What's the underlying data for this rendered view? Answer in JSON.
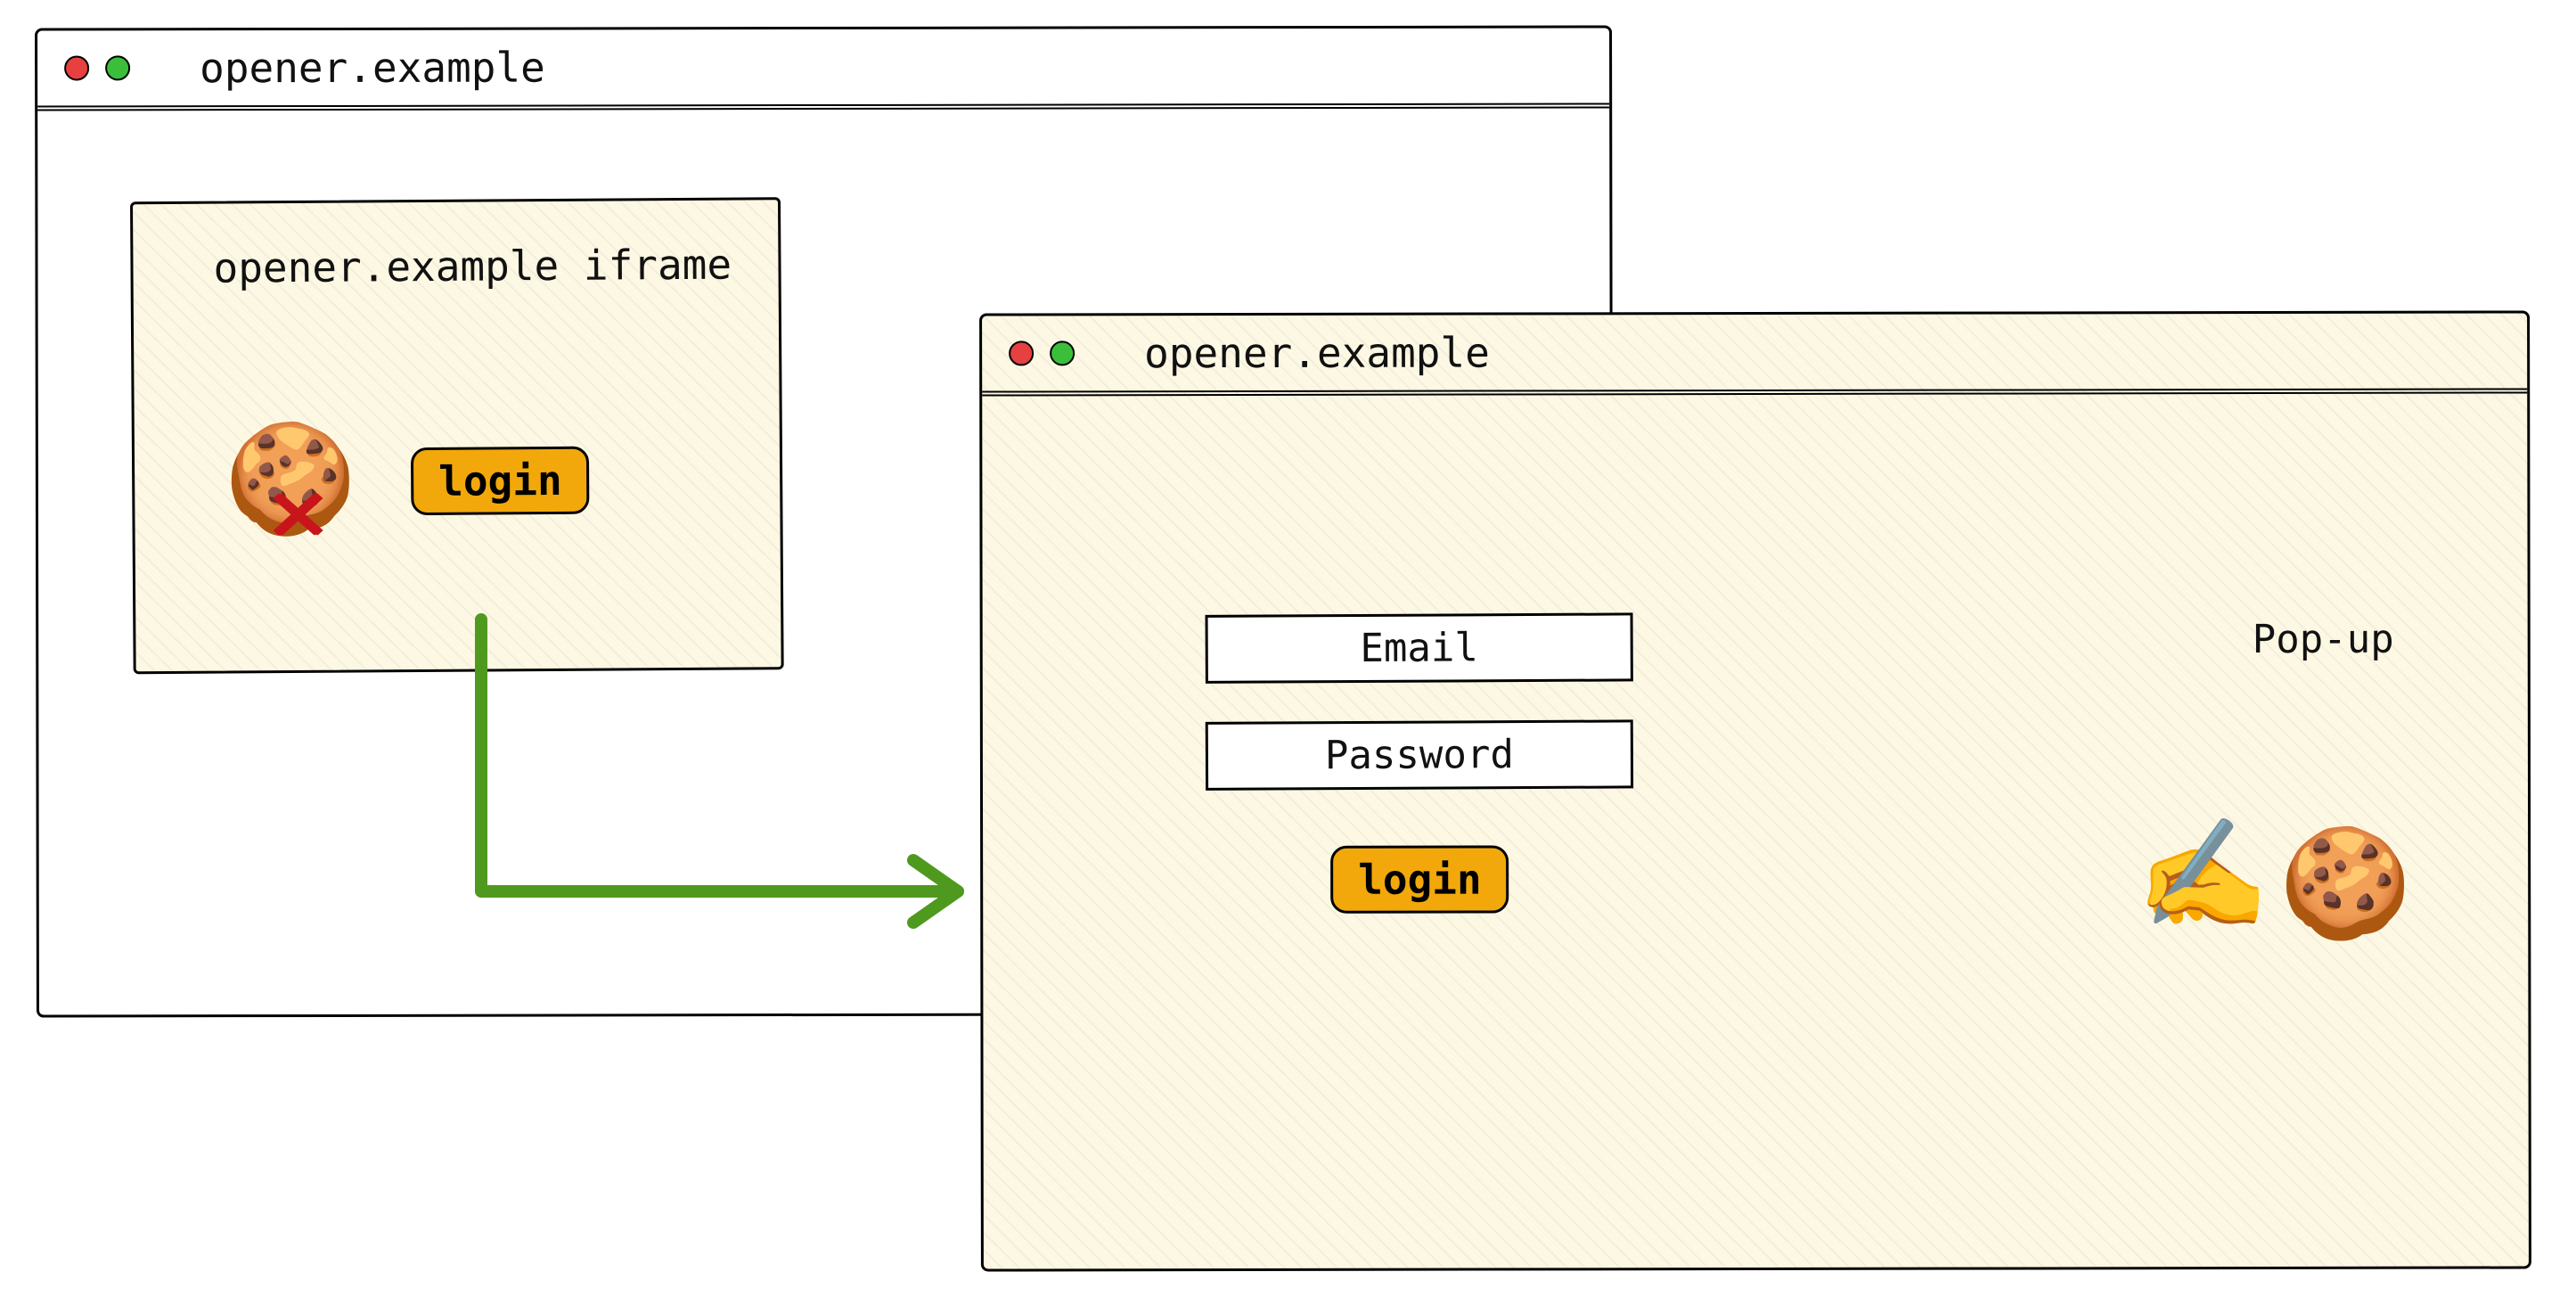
{
  "left_window": {
    "address": "opener.example",
    "iframe": {
      "title": "opener.example iframe",
      "login_button": "login",
      "cookie_icon": "🍪",
      "blocked_marker": "✕"
    }
  },
  "popup_window": {
    "address": "opener.example",
    "label": "Pop-up",
    "email_field": "Email",
    "password_field": "Password",
    "login_button": "login",
    "writing_icon": "✍️",
    "cookie_icon": "🍪"
  },
  "arrow": {
    "color": "#4f9a1e"
  }
}
